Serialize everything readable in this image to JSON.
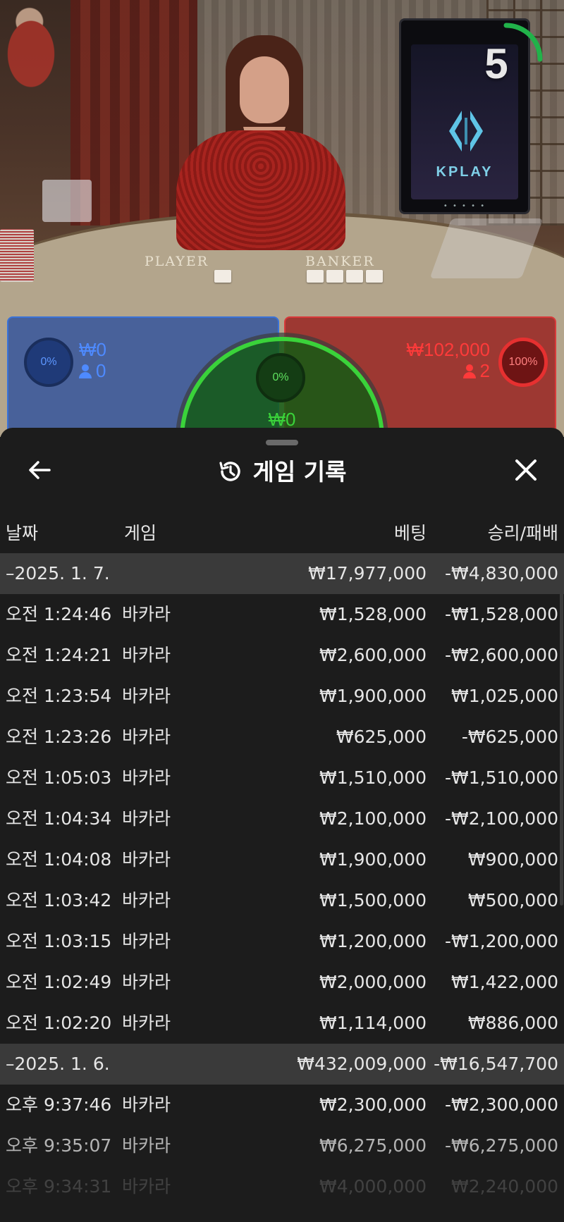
{
  "video": {
    "countdown": "5",
    "monitor_brand": "KPLAY",
    "monitor_dots": "• • • • •",
    "table_labels": {
      "player": "PLAYER",
      "banker": "BANKER"
    }
  },
  "bets": {
    "player": {
      "percent": "0%",
      "amount": "₩0",
      "players": "0",
      "color": "#3a72d8"
    },
    "banker": {
      "percent": "100%",
      "amount": "₩102,000",
      "players": "2",
      "color": "#e63030"
    },
    "tie": {
      "percent": "0%",
      "amount": "₩0",
      "color": "#3ad33a"
    }
  },
  "history": {
    "title": "게임 기록",
    "icons": {
      "back": "arrow-left-icon",
      "close": "close-icon",
      "title": "history-icon"
    },
    "columns": {
      "date": "날짜",
      "game": "게임",
      "bet": "베팅",
      "result": "승리/패배"
    },
    "groups": [
      {
        "date": "–2025. 1. 7.",
        "total_bet": "₩17,977,000",
        "total_result": "-₩4,830,000",
        "rows": [
          {
            "time": "오전 1:24:46",
            "game": "바카라",
            "bet": "₩1,528,000",
            "result": "-₩1,528,000"
          },
          {
            "time": "오전 1:24:21",
            "game": "바카라",
            "bet": "₩2,600,000",
            "result": "-₩2,600,000"
          },
          {
            "time": "오전 1:23:54",
            "game": "바카라",
            "bet": "₩1,900,000",
            "result": "₩1,025,000"
          },
          {
            "time": "오전 1:23:26",
            "game": "바카라",
            "bet": "₩625,000",
            "result": "-₩625,000"
          },
          {
            "time": "오전 1:05:03",
            "game": "바카라",
            "bet": "₩1,510,000",
            "result": "-₩1,510,000"
          },
          {
            "time": "오전 1:04:34",
            "game": "바카라",
            "bet": "₩2,100,000",
            "result": "-₩2,100,000"
          },
          {
            "time": "오전 1:04:08",
            "game": "바카라",
            "bet": "₩1,900,000",
            "result": "₩900,000"
          },
          {
            "time": "오전 1:03:42",
            "game": "바카라",
            "bet": "₩1,500,000",
            "result": "₩500,000"
          },
          {
            "time": "오전 1:03:15",
            "game": "바카라",
            "bet": "₩1,200,000",
            "result": "-₩1,200,000"
          },
          {
            "time": "오전 1:02:49",
            "game": "바카라",
            "bet": "₩2,000,000",
            "result": "₩1,422,000"
          },
          {
            "time": "오전 1:02:20",
            "game": "바카라",
            "bet": "₩1,114,000",
            "result": "₩886,000"
          }
        ]
      },
      {
        "date": "–2025. 1. 6.",
        "total_bet": "₩432,009,000",
        "total_result": "-₩16,547,700",
        "rows": [
          {
            "time": "오후 9:37:46",
            "game": "바카라",
            "bet": "₩2,300,000",
            "result": "-₩2,300,000"
          },
          {
            "time": "오후 9:35:07",
            "game": "바카라",
            "bet": "₩6,275,000",
            "result": "-₩6,275,000"
          },
          {
            "time": "오후 9:34:31",
            "game": "바카라",
            "bet": "₩4,000,000",
            "result": "₩2,240,000"
          }
        ]
      }
    ]
  }
}
